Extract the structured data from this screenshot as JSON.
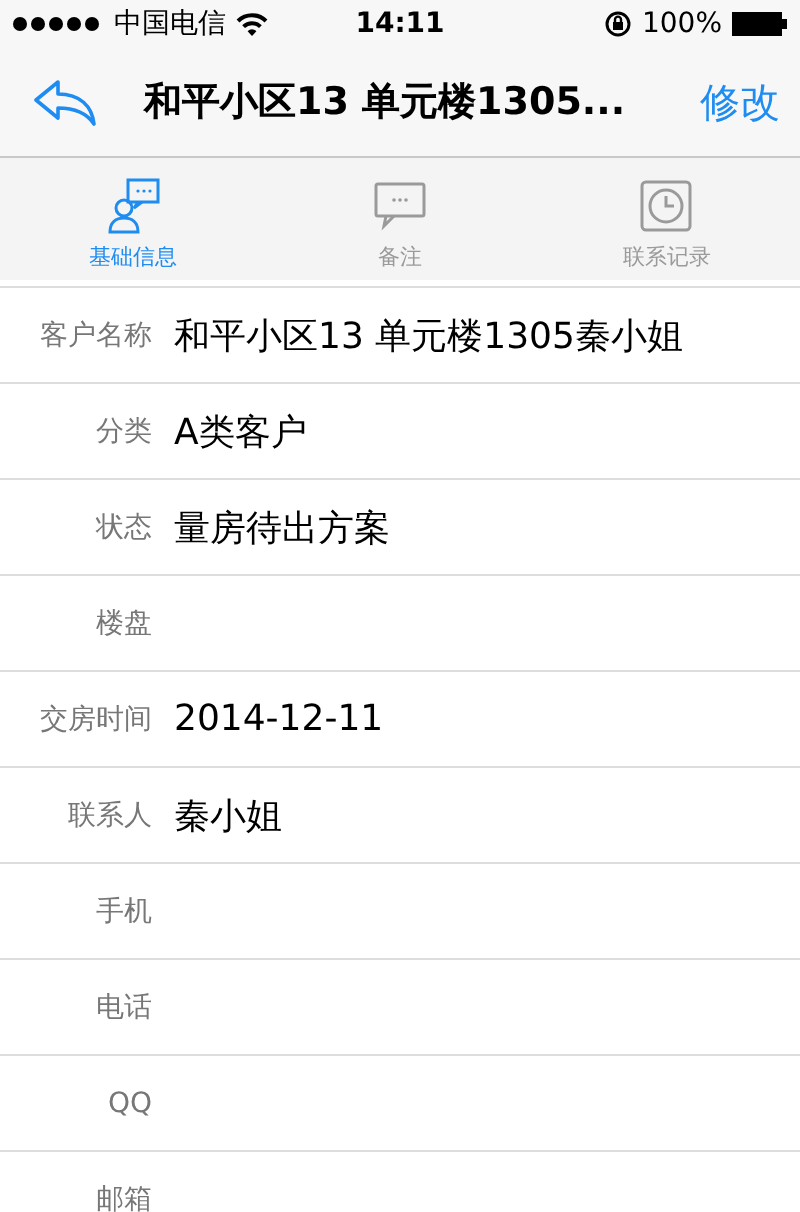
{
  "status_bar": {
    "carrier": "中国电信",
    "time": "14:11",
    "battery": "100%"
  },
  "nav": {
    "title": "和平小区13 单元楼1305...",
    "action": "修改"
  },
  "tabs": [
    {
      "label": "基础信息",
      "selected": true,
      "kind": "person"
    },
    {
      "label": "备注",
      "selected": false,
      "kind": "note"
    },
    {
      "label": "联系记录",
      "selected": false,
      "kind": "clock"
    }
  ],
  "fields": [
    {
      "label": "客户名称",
      "value": "和平小区13 单元楼1305秦小姐"
    },
    {
      "label": "分类",
      "value": "A类客户"
    },
    {
      "label": "状态",
      "value": "量房待出方案"
    },
    {
      "label": "楼盘"
    },
    {
      "label": "交房时间",
      "value": "2014-12-11"
    },
    {
      "label": "联系人",
      "value": "秦小姐"
    },
    {
      "label": "手机"
    },
    {
      "label": "电话"
    },
    {
      "label": "QQ"
    },
    {
      "label": "邮箱"
    }
  ]
}
